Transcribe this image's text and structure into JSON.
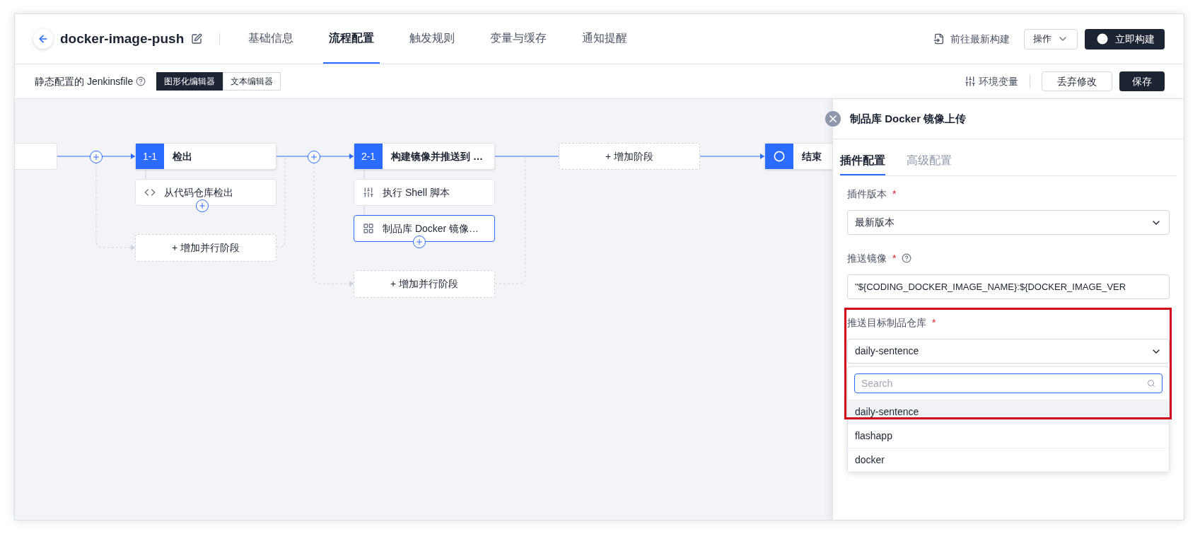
{
  "header": {
    "title": "docker-image-push",
    "tabs": [
      {
        "label": "基础信息",
        "selected": false
      },
      {
        "label": "流程配置",
        "selected": true
      },
      {
        "label": "触发规则",
        "selected": false
      },
      {
        "label": "变量与缓存",
        "selected": false
      },
      {
        "label": "通知提醒",
        "selected": false
      }
    ],
    "latest_build_link": "前往最新构建",
    "actions_menu": "操作",
    "build_button": "立即构建"
  },
  "toolbar": {
    "label": "静态配置的 Jenkinsfile",
    "editor_modes": [
      {
        "label": "图形化编辑器",
        "selected": true
      },
      {
        "label": "文本编辑器",
        "selected": false
      }
    ],
    "env_vars": "环境变量",
    "discard_button": "丢弃修改",
    "save_button": "保存"
  },
  "pipeline": {
    "stages": [
      {
        "badge": "1-1",
        "title": "检出",
        "steps": [
          {
            "kind": "code",
            "label": "从代码仓库检出",
            "selected": false
          }
        ],
        "add_parallel": "+ 增加并行阶段"
      },
      {
        "badge": "2-1",
        "title": "构建镜像并推送到 …",
        "steps": [
          {
            "kind": "shell",
            "label": "执行 Shell 脚本",
            "selected": false
          },
          {
            "kind": "plugin",
            "label": "制品库 Docker 镜像…",
            "selected": true
          }
        ],
        "add_parallel": "+ 增加并行阶段"
      }
    ],
    "add_stage": "+ 增加阶段",
    "end_node": "结束"
  },
  "panel": {
    "title": "制品库 Docker 镜像上传",
    "tabs": [
      {
        "label": "插件配置",
        "selected": true
      },
      {
        "label": "高级配置",
        "selected": false
      }
    ],
    "fields": [
      {
        "kind": "select",
        "label": "插件版本",
        "required_mark": "*",
        "help": false,
        "highlighted": false,
        "value": "最新版本"
      },
      {
        "kind": "input",
        "label": "推送镜像",
        "required_mark": "*",
        "help": true,
        "highlighted": false,
        "value": "\"${CODING_DOCKER_IMAGE_NAME}:${DOCKER_IMAGE_VER"
      },
      {
        "kind": "select",
        "label": "推送目标制品仓库",
        "required_mark": "*",
        "help": false,
        "highlighted": true,
        "value": "daily-sentence",
        "dropdown": {
          "search_placeholder": "Search",
          "options": [
            {
              "label": "daily-sentence",
              "selected": true
            },
            {
              "label": "flashapp",
              "selected": false
            },
            {
              "label": "docker",
              "selected": false
            }
          ]
        }
      }
    ]
  }
}
